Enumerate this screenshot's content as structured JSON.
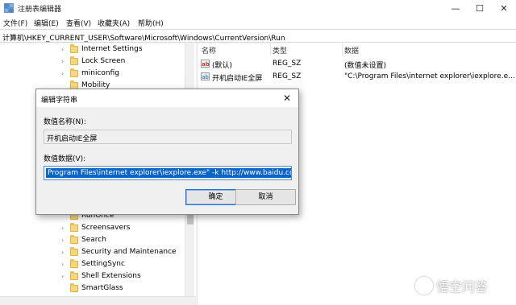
{
  "window": {
    "title": "注册表编辑器",
    "buttons": {
      "minimize": "—",
      "maximize": "☐",
      "close": "✕"
    }
  },
  "menu": [
    "文件(F)",
    "编辑(E)",
    "查看(V)",
    "收藏夹(A)",
    "帮助(H)"
  ],
  "address": "计算机\\HKEY_CURRENT_USER\\Software\\Microsoft\\Windows\\CurrentVersion\\Run",
  "tree": {
    "top_items": [
      "Internet Settings",
      "Lock Screen",
      "miniconfig",
      "Mobility"
    ],
    "bottom_items": [
      "RunOnce",
      "Screensavers",
      "Search",
      "Security and Maintenance",
      "SettingSync",
      "Shell Extensions",
      "SmartGlass"
    ]
  },
  "list": {
    "headers": [
      "名称",
      "类型",
      "数据"
    ],
    "rows": [
      {
        "icon": "ab",
        "name": "(默认)",
        "type": "REG_SZ",
        "data": "(数值未设置)"
      },
      {
        "icon": "ab",
        "name": "开机启动IE全屏",
        "type": "REG_SZ",
        "data": "\"C:\\Program Files\\internet explorer\\iexplore.e..."
      }
    ]
  },
  "dialog": {
    "title": "编辑字符串",
    "close": "✕",
    "name_label": "数值名称(N):",
    "name_value": "开机启动IE全屏",
    "data_label": "数值数据(V):",
    "data_value": "Program Files\\internet explorer\\iexplore.exe\" -k http://www.baidu.com",
    "ok": "确定",
    "cancel": "取消"
  },
  "watermark": "悟空问答"
}
